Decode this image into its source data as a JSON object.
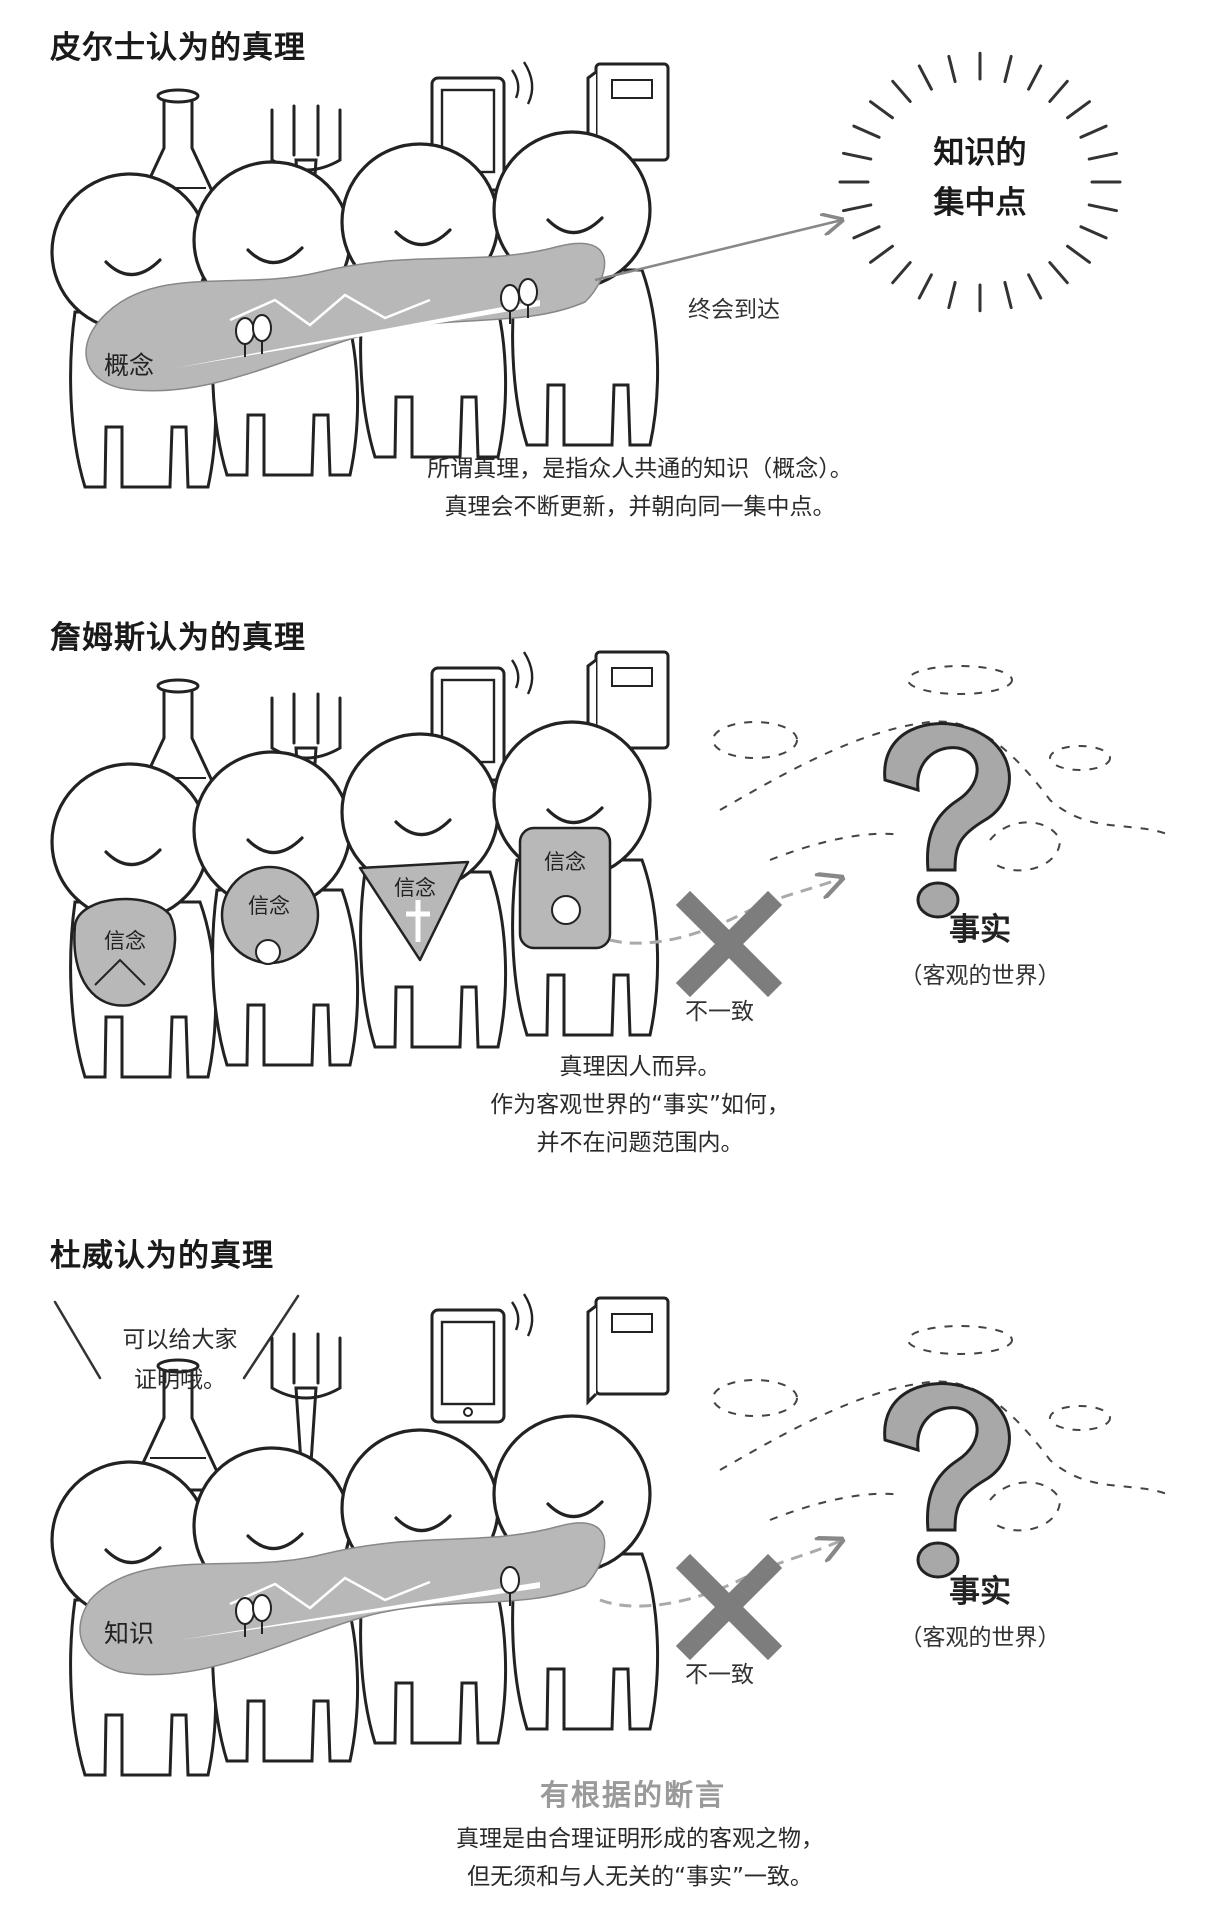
{
  "sections": [
    {
      "title": "皮尔士认为的真理",
      "band_label": "概念",
      "arrow_label": "终会到达",
      "sun_line1": "知识的",
      "sun_line2": "集中点",
      "caption_line1": "所谓真理，是指众人共通的知识（概念）。",
      "caption_line2": "真理会不断更新，并朝向同一集中点。"
    },
    {
      "title": "詹姆斯认为的真理",
      "belief_label": "信念",
      "mismatch_label": "不一致",
      "fact_title": "事实",
      "fact_sub": "（客观的世界）",
      "caption_line1": "真理因人而异。",
      "caption_line2": "作为客观世界的“事实”如何，",
      "caption_line3": "并不在问题范围内。"
    },
    {
      "title": "杜威认为的真理",
      "speech_line1": "可以给大家",
      "speech_line2": "证明哦。",
      "band_label": "知识",
      "mismatch_label": "不一致",
      "fact_title": "事实",
      "fact_sub": "（客观的世界）",
      "highlight": "有根据的断言",
      "caption_line1": "真理是由合理证明形成的客观之物，",
      "caption_line2": "但无须和与人无关的“事实”一致。"
    }
  ],
  "colors": {
    "gray_fill": "#b8b8b8",
    "cross": "#7d7d7d",
    "ink": "#222222",
    "accent_text": "#9a9a9a"
  }
}
